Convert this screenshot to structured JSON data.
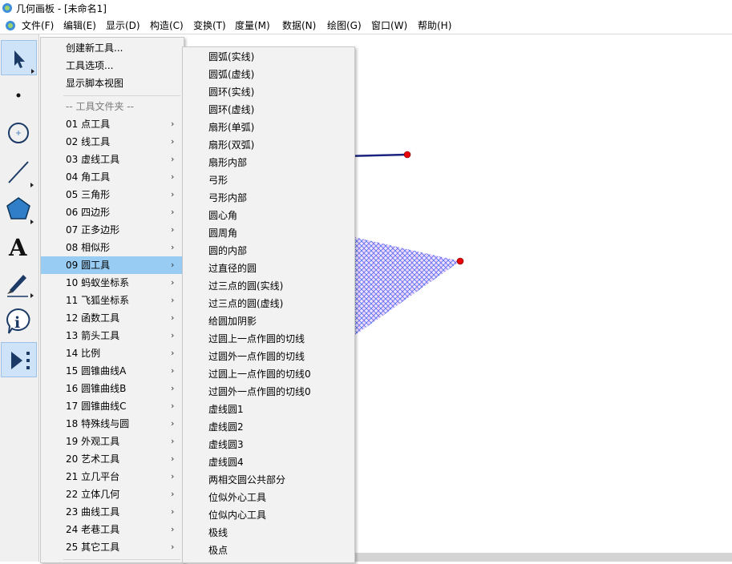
{
  "window": {
    "title": "几何画板 - [未命名1]"
  },
  "menubar": {
    "items": [
      "文件(F)",
      "编辑(E)",
      "显示(D)",
      "构造(C)",
      "变换(T)",
      "度量(M)",
      "数据(N)",
      "绘图(G)",
      "窗口(W)",
      "帮助(H)"
    ]
  },
  "toolbar": {
    "tools": [
      "arrow-select-tool",
      "point-tool",
      "compass-tool",
      "straightedge-tool",
      "polygon-tool",
      "text-tool",
      "marker-tool",
      "information-tool",
      "custom-tool"
    ]
  },
  "colors": {
    "menu_bg": "#f2f2f2",
    "highlight": "#99ccf3",
    "segment": "#1a237e",
    "point": "#e8000b",
    "hatch": "#4c6cf0"
  },
  "tools_menu": {
    "items": [
      {
        "label": "创建新工具..."
      },
      {
        "label": "工具选项..."
      },
      {
        "label": "显示脚本视图"
      },
      {
        "label": "-- 工具文件夹 --",
        "disabled": true
      },
      {
        "label": "01 点工具",
        "submenu": true
      },
      {
        "label": "02 线工具",
        "submenu": true
      },
      {
        "label": "03 虚线工具",
        "submenu": true
      },
      {
        "label": "04 角工具",
        "submenu": true
      },
      {
        "label": "05 三角形",
        "submenu": true
      },
      {
        "label": "06 四边形",
        "submenu": true
      },
      {
        "label": "07 正多边形",
        "submenu": true
      },
      {
        "label": "08 相似形",
        "submenu": true
      },
      {
        "label": "09 圆工具",
        "submenu": true,
        "highlighted": true
      },
      {
        "label": "10 蚂蚁坐标系",
        "submenu": true
      },
      {
        "label": "11 飞狐坐标系",
        "submenu": true
      },
      {
        "label": "12 函数工具",
        "submenu": true
      },
      {
        "label": "13 箭头工具",
        "submenu": true
      },
      {
        "label": "14 比例",
        "submenu": true
      },
      {
        "label": "15 圆锥曲线A",
        "submenu": true
      },
      {
        "label": "16 圆锥曲线B",
        "submenu": true
      },
      {
        "label": "17 圆锥曲线C",
        "submenu": true
      },
      {
        "label": "18 特殊线与圆",
        "submenu": true
      },
      {
        "label": "19 外观工具",
        "submenu": true
      },
      {
        "label": "20 艺术工具",
        "submenu": true
      },
      {
        "label": "21 立几平台",
        "submenu": true
      },
      {
        "label": "22 立体几何",
        "submenu": true
      },
      {
        "label": "23 曲线工具",
        "submenu": true
      },
      {
        "label": "24 老巷工具",
        "submenu": true
      },
      {
        "label": "25 其它工具",
        "submenu": true
      }
    ]
  },
  "circle_submenu": {
    "items": [
      "圆弧(实线)",
      "圆弧(虚线)",
      "圆环(实线)",
      "圆环(虚线)",
      "扇形(单弧)",
      "扇形(双弧)",
      "扇形内部",
      "弓形",
      "弓形内部",
      "圆心角",
      "圆周角",
      "圆的内部",
      "过直径的圆",
      "过三点的圆(实线)",
      "过三点的圆(虚线)",
      "给圆加阴影",
      "过圆上一点作圆的切线",
      "过圆外一点作圆的切线",
      "过圆上一点作圆的切线0",
      "过圆外一点作圆的切线0",
      "虚线圆1",
      "虚线圆2",
      "虚线圆3",
      "虚线圆4",
      "两相交圆公共部分",
      "位似外心工具",
      "位似内心工具",
      "极线",
      "极点"
    ]
  }
}
